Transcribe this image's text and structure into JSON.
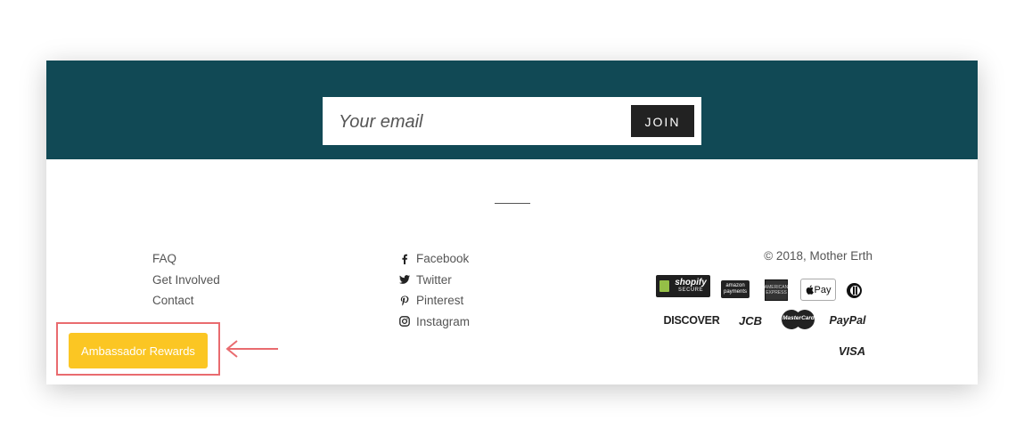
{
  "newsletter": {
    "email_placeholder": "Your email",
    "join_label": "JOIN",
    "background_color": "#114955"
  },
  "footer": {
    "links": [
      {
        "label": "FAQ"
      },
      {
        "label": "Get Involved"
      },
      {
        "label": "Contact"
      }
    ],
    "social": [
      {
        "label": "Facebook",
        "icon": "facebook-icon"
      },
      {
        "label": "Twitter",
        "icon": "twitter-icon"
      },
      {
        "label": "Pinterest",
        "icon": "pinterest-icon"
      },
      {
        "label": "Instagram",
        "icon": "instagram-icon"
      }
    ],
    "copyright": "© 2018, Mother Erth",
    "payments": {
      "shopify": "shopify",
      "shopify_sub": "SECURE",
      "amazon": "amazon",
      "amazon_sub": "payments",
      "amex": "AMERICAN EXPRESS",
      "applepay": "Pay",
      "discover": "DISCOVER",
      "jcb": "JCB",
      "mastercard": "MasterCard",
      "paypal": "PayPal",
      "visa": "VISA"
    }
  },
  "ambassador": {
    "label": "Ambassador Rewards",
    "color": "#fbc623",
    "highlight_color": "#e96b6f"
  }
}
